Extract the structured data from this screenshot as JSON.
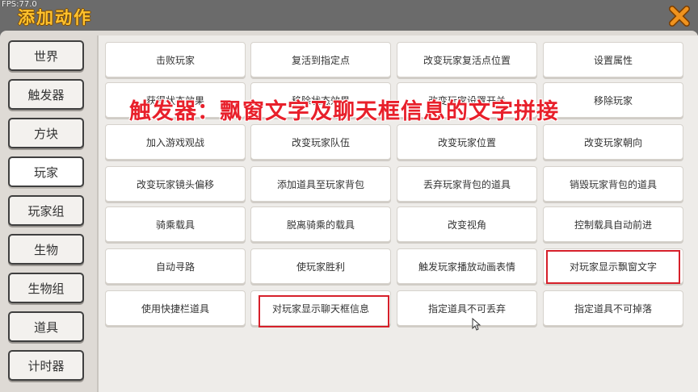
{
  "fps": "FPS:77.0",
  "title": "添加动作",
  "overlay_text": "触发器：飘窗文字及聊天框信息的文字拼接",
  "sidebar": {
    "items": [
      {
        "label": "世界"
      },
      {
        "label": "触发器"
      },
      {
        "label": "方块"
      },
      {
        "label": "玩家",
        "active": true
      },
      {
        "label": "玩家组"
      },
      {
        "label": "生物"
      },
      {
        "label": "生物组"
      },
      {
        "label": "道具"
      },
      {
        "label": "计时器"
      }
    ]
  },
  "actions": [
    "击败玩家",
    "复活到指定点",
    "改变玩家复活点位置",
    "设置属性",
    "获得状态效果",
    "移除状态效果",
    "改变玩家设置开关",
    "移除玩家",
    "加入游戏观战",
    "改变玩家队伍",
    "改变玩家位置",
    "改变玩家朝向",
    "改变玩家镜头偏移",
    "添加道具至玩家背包",
    "丢弃玩家背包的道具",
    "销毁玩家背包的道具",
    "骑乘载具",
    "脱离骑乘的载具",
    "改变视角",
    "控制载具自动前进",
    "自动寻路",
    "使玩家胜利",
    "触发玩家播放动画表情",
    "对玩家显示飘窗文字",
    "使用快捷栏道具",
    "对玩家显示聊天框信息",
    "指定道具不可丢弃",
    "指定道具不可掉落"
  ],
  "colors": {
    "title": "#ffc22e",
    "highlight": "#d6202a",
    "overlay": "#e8202b",
    "close": "#f0931e"
  }
}
